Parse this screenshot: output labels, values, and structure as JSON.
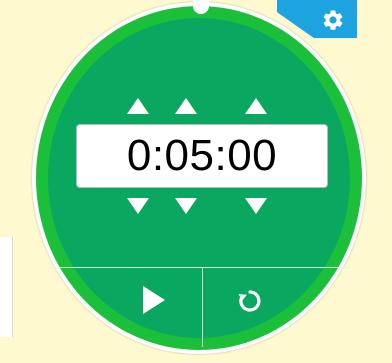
{
  "timer": {
    "display": "0:05:00",
    "colors": {
      "ring": "#1cbf3a",
      "face": "#0aa761",
      "background": "#fff9cf",
      "settings_tab": "#1da3e0"
    },
    "icons": {
      "settings": "gear-icon",
      "increment": "triangle-up-icon",
      "decrement": "triangle-down-icon",
      "start": "play-icon",
      "reset": "reset-icon"
    }
  }
}
